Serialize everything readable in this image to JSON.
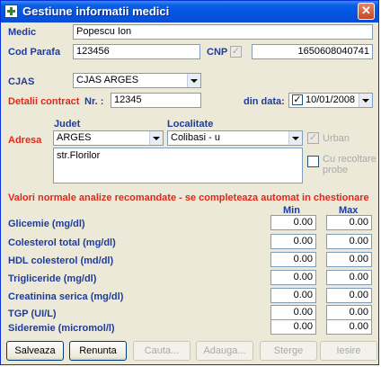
{
  "window": {
    "title": "Gestiune informatii medici",
    "close_glyph": "✕",
    "icon": "medical-cross-icon"
  },
  "form": {
    "medic_label": "Medic",
    "medic_value": "Popescu Ion",
    "cod_parafa_label": "Cod Parafa",
    "cod_parafa_value": "123456",
    "cnp_label": "CNP",
    "cnp_value": "1650608040741",
    "cjas_label": "CJAS",
    "cjas_value": "CJAS ARGES",
    "detalii_label": "Detalii contract",
    "nr_label": "Nr. :",
    "nr_value": "12345",
    "din_data_label": "din data:",
    "date_value": "10/01/2008",
    "date_checked": "✓",
    "adresa_label": "Adresa",
    "judet_label": "Judet",
    "judet_value": "ARGES",
    "localitate_label": "Localitate",
    "localitate_value": "Colibasi - u",
    "urban_label": "Urban",
    "urban_check": "✓",
    "strada_value": "str.Florilor",
    "cu_recoltare_label_1": "Cu recoltare",
    "cu_recoltare_label_2": "probe"
  },
  "analyses": {
    "heading": "Valori normale analize recomandate - se completeaza automat in chestionare",
    "min_label": "Min",
    "max_label": "Max",
    "rows": [
      {
        "name": "Glicemie (mg/dl)",
        "min": "0.00",
        "max": "0.00"
      },
      {
        "name": "Colesterol total (mg/dl)",
        "min": "0.00",
        "max": "0.00"
      },
      {
        "name": "HDL colesterol (md/dl)",
        "min": "0.00",
        "max": "0.00"
      },
      {
        "name": "Trigliceride (mg/dl)",
        "min": "0.00",
        "max": "0.00"
      },
      {
        "name": "Creatinina serica (mg/dl)",
        "min": "0.00",
        "max": "0.00"
      },
      {
        "name": "TGP (UI/L)",
        "min": "0.00",
        "max": "0.00"
      },
      {
        "name": "Sideremie  (micromol/l)",
        "min": "0.00",
        "max": "0.00"
      }
    ]
  },
  "buttons": {
    "salveaza": "Salveaza",
    "renunta": "Renunta",
    "cauta": "Cauta...",
    "adauga": "Adauga...",
    "sterge": "Sterge",
    "iesire": "Iesire"
  }
}
